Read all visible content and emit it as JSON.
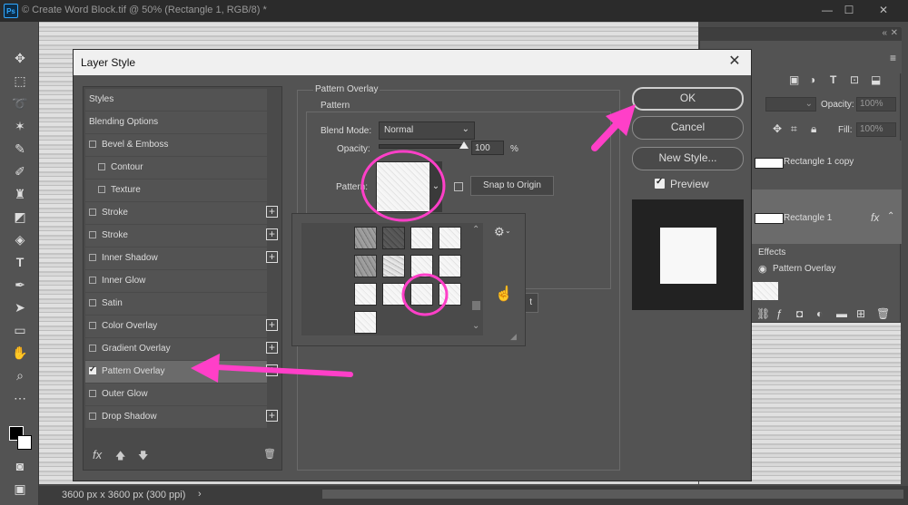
{
  "app": {
    "logo": "Ps",
    "doc_tab": "© Create Word Block.tif @ 50% (Rectangle 1, RGB/8) *",
    "status": "3600 px x 3600 px (300 ppi)",
    "status_chevron": "›",
    "window_controls": [
      "—",
      "☐",
      "✕"
    ]
  },
  "layers_panel": {
    "opacity_label": "Opacity:",
    "opacity_value": "100%",
    "fill_label": "Fill:",
    "fill_value": "100%",
    "layers": [
      {
        "name": "Rectangle 1 copy"
      },
      {
        "name": "Rectangle 1",
        "fx": "fx"
      }
    ],
    "effects_label": "Effects",
    "effect_item": "Pattern Overlay"
  },
  "dialog": {
    "title": "Layer Style",
    "close": "✕",
    "styles": [
      {
        "label": "Styles",
        "check": null,
        "plus": false,
        "indent": 0
      },
      {
        "label": "Blending Options",
        "check": null,
        "plus": false,
        "indent": 0
      },
      {
        "label": "Bevel & Emboss",
        "check": false,
        "plus": false,
        "indent": 0
      },
      {
        "label": "Contour",
        "check": false,
        "plus": false,
        "indent": 1
      },
      {
        "label": "Texture",
        "check": false,
        "plus": false,
        "indent": 1
      },
      {
        "label": "Stroke",
        "check": false,
        "plus": true,
        "indent": 0
      },
      {
        "label": "Stroke",
        "check": false,
        "plus": true,
        "indent": 0
      },
      {
        "label": "Inner Shadow",
        "check": false,
        "plus": true,
        "indent": 0
      },
      {
        "label": "Inner Glow",
        "check": false,
        "plus": false,
        "indent": 0
      },
      {
        "label": "Satin",
        "check": false,
        "plus": false,
        "indent": 0
      },
      {
        "label": "Color Overlay",
        "check": false,
        "plus": true,
        "indent": 0
      },
      {
        "label": "Gradient Overlay",
        "check": false,
        "plus": true,
        "indent": 0
      },
      {
        "label": "Pattern Overlay",
        "check": true,
        "plus": true,
        "indent": 0,
        "selected": true
      },
      {
        "label": "Outer Glow",
        "check": false,
        "plus": false,
        "indent": 0
      },
      {
        "label": "Drop Shadow",
        "check": false,
        "plus": true,
        "indent": 0
      }
    ],
    "fx_label": "fx",
    "section_title": "Pattern Overlay",
    "group_title": "Pattern",
    "blend_mode_label": "Blend Mode:",
    "blend_mode_value": "Normal",
    "opacity_label": "Opacity:",
    "opacity_value": "100",
    "opacity_percent": "%",
    "opacity_fraction": 1.0,
    "pattern_label": "Pattern:",
    "snap_to_origin": "Snap to Origin",
    "hidden_button_fragment": "t",
    "ok": "OK",
    "cancel": "Cancel",
    "new_style": "New Style...",
    "preview_label": "Preview"
  },
  "colors": {
    "annotation": "#ff3fc8",
    "panel": "#535353",
    "dark": "#3c3c3c"
  }
}
